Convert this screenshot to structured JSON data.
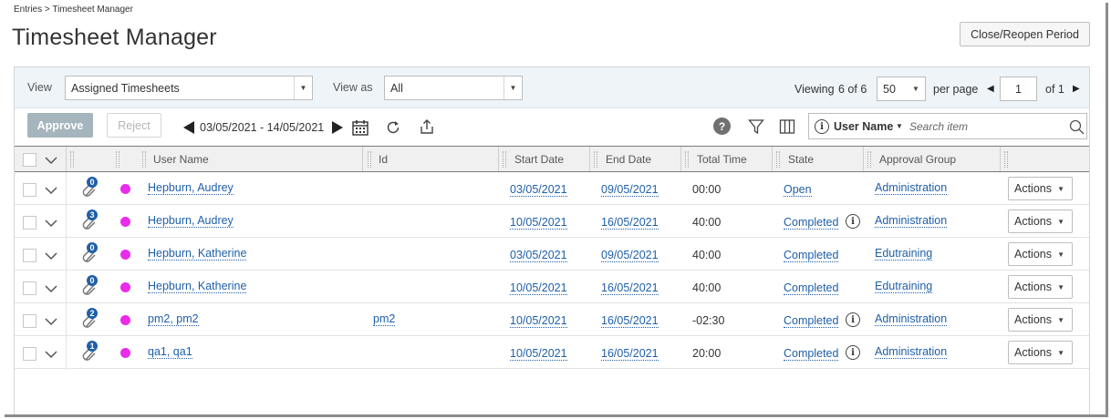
{
  "breadcrumb": "Entries > Timesheet Manager",
  "page_title": "Timesheet Manager",
  "close_period_label": "Close/Reopen Period",
  "filter": {
    "view_label": "View",
    "view_value": "Assigned Timesheets",
    "view_as_label": "View as",
    "view_as_value": "All",
    "viewing_text": "Viewing",
    "viewing_count": "6 of 6",
    "per_page_value": "50",
    "per_page_label": "per page",
    "page_value": "1",
    "of_pages": "of 1"
  },
  "toolbar": {
    "approve_label": "Approve",
    "reject_label": "Reject",
    "date_range": "03/05/2021 - 14/05/2021",
    "search_field_label": "User Name",
    "search_placeholder": "Search item"
  },
  "columns": [
    "User Name",
    "Id",
    "Start Date",
    "End Date",
    "Total Time",
    "State",
    "Approval Group"
  ],
  "rows": [
    {
      "badge": "0",
      "user": "Hepburn, Audrey",
      "id": "",
      "start": "03/05/2021",
      "end": "09/05/2021",
      "total": "00:00",
      "state": "Open",
      "info": false,
      "group": "Administration",
      "actions": "Actions"
    },
    {
      "badge": "3",
      "user": "Hepburn, Audrey",
      "id": "",
      "start": "10/05/2021",
      "end": "16/05/2021",
      "total": "40:00",
      "state": "Completed",
      "info": true,
      "group": "Administration",
      "actions": "Actions"
    },
    {
      "badge": "0",
      "user": "Hepburn, Katherine",
      "id": "",
      "start": "03/05/2021",
      "end": "09/05/2021",
      "total": "40:00",
      "state": "Completed",
      "info": false,
      "group": "Edutraining",
      "actions": "Actions"
    },
    {
      "badge": "0",
      "user": "Hepburn, Katherine",
      "id": "",
      "start": "10/05/2021",
      "end": "16/05/2021",
      "total": "40:00",
      "state": "Completed",
      "info": false,
      "group": "Edutraining",
      "actions": "Actions"
    },
    {
      "badge": "2",
      "user": "pm2, pm2",
      "id": "pm2",
      "start": "10/05/2021",
      "end": "16/05/2021",
      "total": "-02:30",
      "state": "Completed",
      "info": true,
      "group": "Administration",
      "actions": "Actions"
    },
    {
      "badge": "1",
      "user": "qa1, qa1",
      "id": "",
      "start": "10/05/2021",
      "end": "16/05/2021",
      "total": "20:00",
      "state": "Completed",
      "info": true,
      "group": "Administration",
      "actions": "Actions"
    }
  ],
  "colors": {
    "accent": "#1f5fa8",
    "status_dot": "#ea2bea",
    "badge": "#1f5fa8",
    "approve_disabled": "#a5b5bd"
  },
  "icons": {
    "date_prev": "triangle-left-icon",
    "date_next": "triangle-right-icon",
    "calendar": "calendar-icon",
    "refresh": "refresh-icon",
    "export": "export-icon",
    "help": "help-icon",
    "filter": "filter-icon",
    "columns": "columns-icon",
    "search": "search-icon",
    "attachment": "paperclip-icon"
  }
}
